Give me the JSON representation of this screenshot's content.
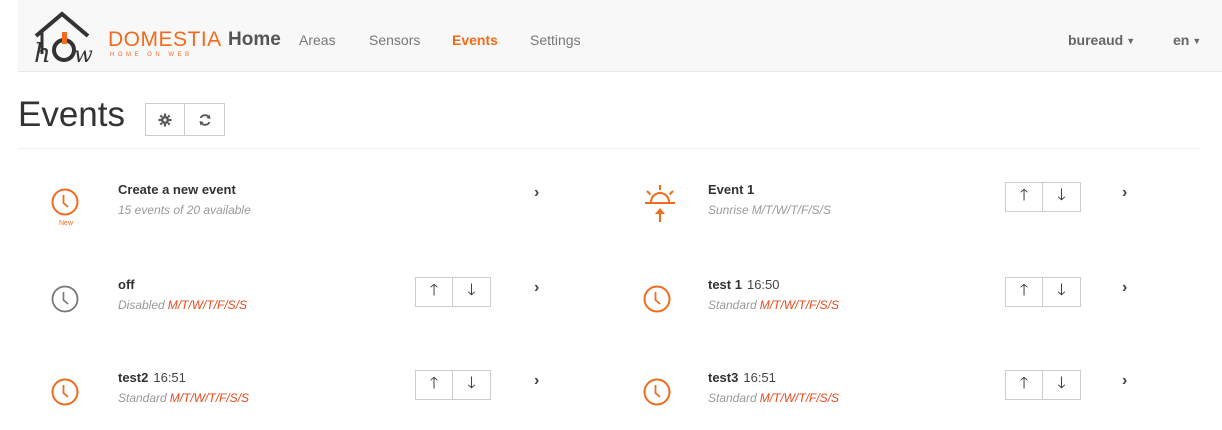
{
  "brand": {
    "name": "DOMESTIA",
    "tagline": "HOME ON WEB",
    "logo_text": "hOw",
    "home_label": "Home"
  },
  "nav": {
    "items": [
      {
        "label": "Areas",
        "active": false
      },
      {
        "label": "Sensors",
        "active": false
      },
      {
        "label": "Events",
        "active": true
      },
      {
        "label": "Settings",
        "active": false
      }
    ],
    "user": "bureaud",
    "lang": "en"
  },
  "page": {
    "title": "Events"
  },
  "create": {
    "title": "Create a new event",
    "subtitle": "15 events of 20 available",
    "icon_badge": "New"
  },
  "events": [
    {
      "name": "Event 1",
      "time": "",
      "type": "Sunrise",
      "days": "M/T/W/T/F/S/S",
      "icon": "sunrise-icon"
    },
    {
      "name": "off",
      "time": "",
      "type": "Disabled",
      "days": "M/T/W/T/F/S/S",
      "icon": "clock-icon"
    },
    {
      "name": "test 1",
      "time": "16:50",
      "type": "Standard",
      "days": "M/T/W/T/F/S/S",
      "icon": "clock-icon"
    },
    {
      "name": "test2",
      "time": "16:51",
      "type": "Standard",
      "days": "M/T/W/T/F/S/S",
      "icon": "clock-icon"
    },
    {
      "name": "test3",
      "time": "16:51",
      "type": "Standard",
      "days": "M/T/W/T/F/S/S",
      "icon": "clock-icon"
    }
  ],
  "colors": {
    "accent": "#f26b1d",
    "days": "#e8491d",
    "disabled_icon": "#777777"
  }
}
